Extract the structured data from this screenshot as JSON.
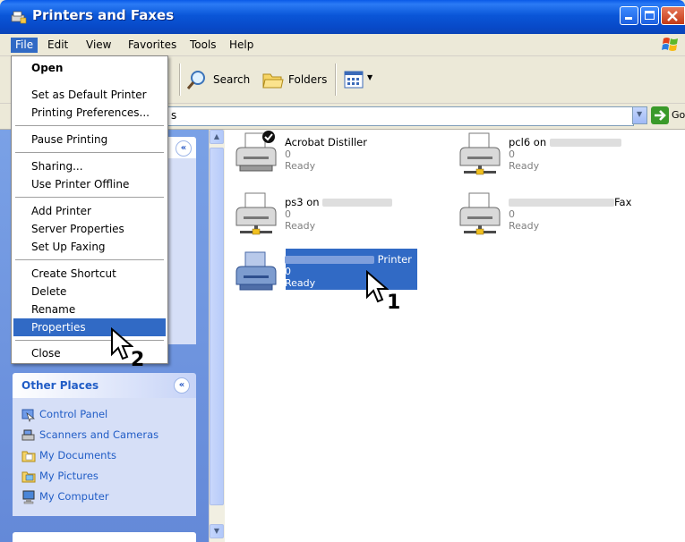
{
  "window": {
    "title": "Printers and Faxes"
  },
  "menubar": {
    "items": [
      "File",
      "Edit",
      "View",
      "Favorites",
      "Tools",
      "Help"
    ]
  },
  "toolbar": {
    "search": "Search",
    "folders": "Folders"
  },
  "addressbar": {
    "fragment": "s",
    "go": "Go"
  },
  "file_menu": {
    "groups": [
      [
        "Open",
        "Set as Default Printer",
        "Printing Preferences..."
      ],
      [
        "Pause Printing"
      ],
      [
        "Sharing...",
        "Use Printer Offline"
      ],
      [
        "Add Printer",
        "Server Properties",
        "Set Up Faxing"
      ],
      [
        "Create Shortcut",
        "Delete",
        "Rename",
        "Properties"
      ],
      [
        "Close"
      ]
    ],
    "highlighted": "Properties"
  },
  "other_places": {
    "title": "Other Places",
    "links": [
      "Control Panel",
      "Scanners and Cameras",
      "My Documents",
      "My Pictures",
      "My Computer"
    ]
  },
  "printers": [
    {
      "name": "Acrobat Distiller",
      "count": "0",
      "status": "Ready",
      "default": true
    },
    {
      "name": "pcl6 on",
      "count": "0",
      "status": "Ready"
    },
    {
      "name": "ps3 on",
      "count": "0",
      "status": "Ready"
    },
    {
      "name": "Fax",
      "count": "0",
      "status": "Ready"
    },
    {
      "name": "Printer",
      "count": "0",
      "status": "Ready",
      "selected": true
    }
  ],
  "annotations": {
    "step1": "1",
    "step2": "2"
  },
  "colors": {
    "titlebar": "#0a56d8",
    "selection": "#316ac5",
    "taskpane": "#6f96de",
    "link": "#215dc6"
  }
}
